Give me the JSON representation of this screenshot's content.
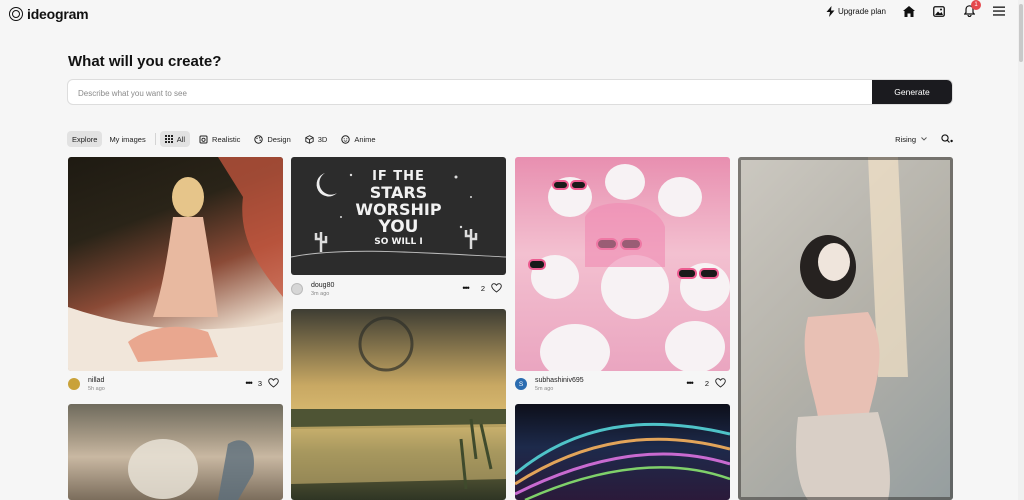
{
  "header": {
    "logo_text": "ideogram",
    "upgrade_label": "Upgrade plan",
    "notification_count": "1"
  },
  "main": {
    "title": "What will you create?",
    "prompt_placeholder": "Describe what you want to see",
    "generate_label": "Generate"
  },
  "filters": {
    "tabs": [
      {
        "label": "Explore",
        "active": true
      },
      {
        "label": "My images",
        "active": false
      }
    ],
    "categories": [
      {
        "label": "All",
        "icon": "grid-icon",
        "active": true
      },
      {
        "label": "Realistic",
        "icon": "camera-icon",
        "active": false
      },
      {
        "label": "Design",
        "icon": "palette-icon",
        "active": false
      },
      {
        "label": "3D",
        "icon": "cube-icon",
        "active": false
      },
      {
        "label": "Anime",
        "icon": "smile-icon",
        "active": false
      }
    ],
    "sort_label": "Rising"
  },
  "cards": [
    {
      "user": "nillad",
      "time": "5h ago",
      "likes": "3",
      "avatar_color": "#c9a23a"
    },
    {
      "user": "doug80",
      "time": "3m ago",
      "likes": "2",
      "avatar_color": "#cfcfcf"
    },
    {
      "user": "subhashiniv695",
      "time": "5m ago",
      "likes": "2",
      "avatar_color": "#2b6cb0",
      "avatar_letter": "S"
    }
  ],
  "poster": {
    "line1": "IF THE",
    "line2": "STARS",
    "line3": "WORSHIP",
    "line4": "YOU",
    "line5": "SO WILL I"
  },
  "colors": {
    "accent": "#1b1b1f",
    "badge": "#e5484d",
    "background": "#f6f6f6"
  }
}
